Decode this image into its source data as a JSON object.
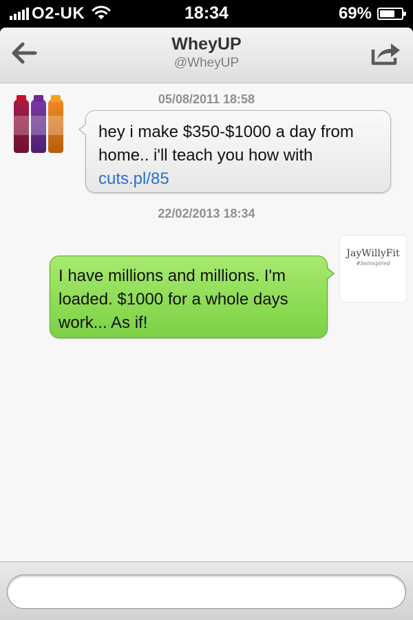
{
  "status_bar": {
    "carrier": "O2-UK",
    "time": "18:34",
    "battery_percent": "69%",
    "battery_level": 0.69,
    "signal_bars": 5
  },
  "nav": {
    "title": "WheyUP",
    "subtitle": "@WheyUP",
    "back_icon": "arrow-left-icon",
    "share_icon": "share-icon"
  },
  "messages": [
    {
      "timestamp": "05/08/2011 18:58",
      "direction": "incoming",
      "text": "hey i make $350-$1000 a day from home.. i'll teach you how with",
      "link": "cuts.pl/85"
    },
    {
      "timestamp": "22/02/2013 18:34",
      "direction": "outgoing",
      "text": "I have millions and millions. I'm loaded. $1000 for a whole days work... As if!",
      "avatar": {
        "brand": "JayWillyFit",
        "tag": "#beinspired"
      }
    }
  ],
  "compose": {
    "value": "",
    "placeholder": ""
  },
  "colors": {
    "outgoing_bubble": "#8ddb55",
    "incoming_bubble": "#f2f2f2",
    "link": "#2a6fcf"
  }
}
